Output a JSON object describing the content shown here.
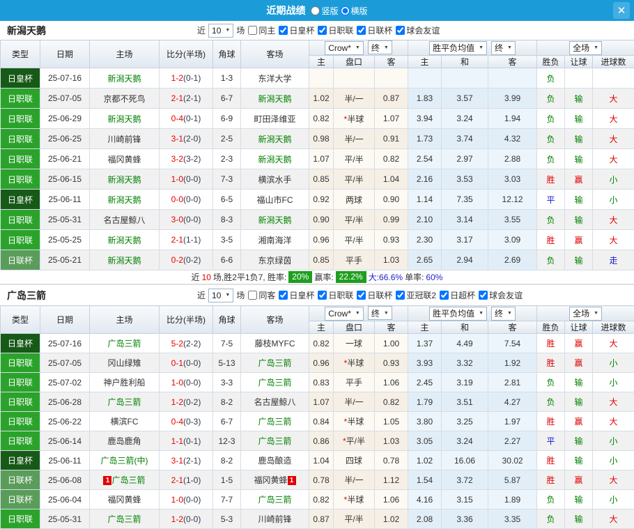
{
  "titlebar": {
    "title": "近期战绩",
    "mode_vertical": "竖版",
    "mode_horizontal": "横版",
    "mode_selected": "横版",
    "close_icon": "✕"
  },
  "colors": {
    "type": {
      "日皇杯": "#175917",
      "日职联": "#2ba32b",
      "日联杯": "#5a9c5a"
    },
    "outcome": {
      "胜": "#e10000",
      "平": "#1414d2",
      "负": "#008000",
      "赢": "#e10000",
      "输": "#008000",
      "走": "#1414d2",
      "大": "#e10000",
      "小": "#008000"
    },
    "focus_team": "#008000",
    "score": "#e60000",
    "badge": "#1f9e1f",
    "titlebar": "#1b9cd8"
  },
  "table_header": {
    "type": "类型",
    "date": "日期",
    "home": "主场",
    "score": "比分(半场)",
    "corner": "角球",
    "away": "客场",
    "crow_dd": "Crow*",
    "final_dd": "终",
    "mean_dd": "胜平负均值",
    "full_dd": "全场",
    "sub": [
      "主",
      "盘口",
      "客",
      "主",
      "和",
      "客",
      "胜负",
      "让球",
      "进球数"
    ]
  },
  "sections": [
    {
      "team": "新潟天鹅",
      "filter": {
        "near": "近",
        "count": "10",
        "games": "场",
        "same": "同主",
        "same_checked": false,
        "leagues": [
          "日皇杯",
          "日职联",
          "日联杯",
          "球会友谊"
        ]
      },
      "rows": [
        {
          "type": "日皇杯",
          "date": "25-07-16",
          "home": "新潟天鹅",
          "home_focus": true,
          "home_card": "",
          "score": "1-2",
          "half": "(0-1)",
          "corner": "1-3",
          "away": "东洋大学",
          "away_focus": false,
          "away_card": "",
          "odds": [
            "",
            "",
            ""
          ],
          "mean": [
            "",
            "",
            ""
          ],
          "results": [
            "负",
            "",
            ""
          ]
        },
        {
          "type": "日职联",
          "date": "25-07-05",
          "home": "京都不死鸟",
          "home_focus": false,
          "home_card": "",
          "score": "2-1",
          "half": "(2-1)",
          "corner": "6-7",
          "away": "新潟天鹅",
          "away_focus": true,
          "away_card": "",
          "odds": [
            "1.02",
            "半/一",
            "0.87"
          ],
          "mean": [
            "1.83",
            "3.57",
            "3.99"
          ],
          "results": [
            "负",
            "输",
            "大"
          ]
        },
        {
          "type": "日职联",
          "date": "25-06-29",
          "home": "新潟天鹅",
          "home_focus": true,
          "home_card": "",
          "score": "0-4",
          "half": "(0-1)",
          "corner": "6-9",
          "away": "町田泽维亚",
          "away_focus": false,
          "away_card": "",
          "odds": [
            "0.82",
            "*半球",
            "1.07"
          ],
          "mean": [
            "3.94",
            "3.24",
            "1.94"
          ],
          "results": [
            "负",
            "输",
            "大"
          ]
        },
        {
          "type": "日职联",
          "date": "25-06-25",
          "home": "川崎前锋",
          "home_focus": false,
          "home_card": "",
          "score": "3-1",
          "half": "(2-0)",
          "corner": "2-5",
          "away": "新潟天鹅",
          "away_focus": true,
          "away_card": "",
          "odds": [
            "0.98",
            "半/一",
            "0.91"
          ],
          "mean": [
            "1.73",
            "3.74",
            "4.32"
          ],
          "results": [
            "负",
            "输",
            "大"
          ]
        },
        {
          "type": "日职联",
          "date": "25-06-21",
          "home": "福冈黄蜂",
          "home_focus": false,
          "home_card": "",
          "score": "3-2",
          "half": "(3-2)",
          "corner": "2-3",
          "away": "新潟天鹅",
          "away_focus": true,
          "away_card": "",
          "odds": [
            "1.07",
            "平/半",
            "0.82"
          ],
          "mean": [
            "2.54",
            "2.97",
            "2.88"
          ],
          "results": [
            "负",
            "输",
            "大"
          ]
        },
        {
          "type": "日职联",
          "date": "25-06-15",
          "home": "新潟天鹅",
          "home_focus": true,
          "home_card": "",
          "score": "1-0",
          "half": "(0-0)",
          "corner": "7-3",
          "away": "横滨水手",
          "away_focus": false,
          "away_card": "",
          "odds": [
            "0.85",
            "平/半",
            "1.04"
          ],
          "mean": [
            "2.16",
            "3.53",
            "3.03"
          ],
          "results": [
            "胜",
            "赢",
            "小"
          ]
        },
        {
          "type": "日皇杯",
          "date": "25-06-11",
          "home": "新潟天鹅",
          "home_focus": true,
          "home_card": "",
          "score": "0-0",
          "half": "(0-0)",
          "corner": "6-5",
          "away": "福山市FC",
          "away_focus": false,
          "away_card": "",
          "odds": [
            "0.92",
            "两球",
            "0.90"
          ],
          "mean": [
            "1.14",
            "7.35",
            "12.12"
          ],
          "results": [
            "平",
            "输",
            "小"
          ]
        },
        {
          "type": "日职联",
          "date": "25-05-31",
          "home": "名古屋鲸八",
          "home_focus": false,
          "home_card": "",
          "score": "3-0",
          "half": "(0-0)",
          "corner": "8-3",
          "away": "新潟天鹅",
          "away_focus": true,
          "away_card": "",
          "odds": [
            "0.90",
            "平/半",
            "0.99"
          ],
          "mean": [
            "2.10",
            "3.14",
            "3.55"
          ],
          "results": [
            "负",
            "输",
            "大"
          ]
        },
        {
          "type": "日职联",
          "date": "25-05-25",
          "home": "新潟天鹅",
          "home_focus": true,
          "home_card": "",
          "score": "2-1",
          "half": "(1-1)",
          "corner": "3-5",
          "away": "湘南海洋",
          "away_focus": false,
          "away_card": "",
          "odds": [
            "0.96",
            "平/半",
            "0.93"
          ],
          "mean": [
            "2.30",
            "3.17",
            "3.09"
          ],
          "results": [
            "胜",
            "赢",
            "大"
          ]
        },
        {
          "type": "日联杯",
          "date": "25-05-21",
          "home": "新潟天鹅",
          "home_focus": true,
          "home_card": "",
          "score": "0-2",
          "half": "(0-2)",
          "corner": "6-6",
          "away": "东京绿茵",
          "away_focus": false,
          "away_card": "",
          "odds": [
            "0.85",
            "平手",
            "1.03"
          ],
          "mean": [
            "2.65",
            "2.94",
            "2.69"
          ],
          "results": [
            "负",
            "输",
            "走"
          ]
        }
      ],
      "summary": {
        "near": "近",
        "count": "10",
        "record": "场,胜2平1负7, 胜率:",
        "win_rate": "20%",
        "profit_label": "赢率:",
        "profit_rate": "22.2%",
        "big": "大:66.6%",
        "single_label": "单率:",
        "single_value": "60%"
      }
    },
    {
      "team": "广岛三箭",
      "filter": {
        "near": "近",
        "count": "10",
        "games": "场",
        "same": "同客",
        "same_checked": false,
        "leagues": [
          "日皇杯",
          "日职联",
          "日联杯",
          "亚冠联2",
          "日超杯",
          "球会友谊"
        ]
      },
      "rows": [
        {
          "type": "日皇杯",
          "date": "25-07-16",
          "home": "广岛三箭",
          "home_focus": true,
          "home_card": "",
          "score": "5-2",
          "half": "(2-2)",
          "corner": "7-5",
          "away": "藤枝MYFC",
          "away_focus": false,
          "away_card": "",
          "odds": [
            "0.82",
            "一球",
            "1.00"
          ],
          "mean": [
            "1.37",
            "4.49",
            "7.54"
          ],
          "results": [
            "胜",
            "赢",
            "大"
          ]
        },
        {
          "type": "日职联",
          "date": "25-07-05",
          "home": "冈山绿雉",
          "home_focus": false,
          "home_card": "",
          "score": "0-1",
          "half": "(0-0)",
          "corner": "5-13",
          "away": "广岛三箭",
          "away_focus": true,
          "away_card": "",
          "odds": [
            "0.96",
            "*半球",
            "0.93"
          ],
          "mean": [
            "3.93",
            "3.32",
            "1.92"
          ],
          "results": [
            "胜",
            "赢",
            "小"
          ]
        },
        {
          "type": "日职联",
          "date": "25-07-02",
          "home": "神户胜利船",
          "home_focus": false,
          "home_card": "",
          "score": "1-0",
          "half": "(0-0)",
          "corner": "3-3",
          "away": "广岛三箭",
          "away_focus": true,
          "away_card": "",
          "odds": [
            "0.83",
            "平手",
            "1.06"
          ],
          "mean": [
            "2.45",
            "3.19",
            "2.81"
          ],
          "results": [
            "负",
            "输",
            "小"
          ]
        },
        {
          "type": "日职联",
          "date": "25-06-28",
          "home": "广岛三箭",
          "home_focus": true,
          "home_card": "",
          "score": "1-2",
          "half": "(0-2)",
          "corner": "8-2",
          "away": "名古屋鲸八",
          "away_focus": false,
          "away_card": "",
          "odds": [
            "1.07",
            "半/一",
            "0.82"
          ],
          "mean": [
            "1.79",
            "3.51",
            "4.27"
          ],
          "results": [
            "负",
            "输",
            "大"
          ]
        },
        {
          "type": "日职联",
          "date": "25-06-22",
          "home": "横滨FC",
          "home_focus": false,
          "home_card": "",
          "score": "0-4",
          "half": "(0-3)",
          "corner": "6-7",
          "away": "广岛三箭",
          "away_focus": true,
          "away_card": "",
          "odds": [
            "0.84",
            "*半球",
            "1.05"
          ],
          "mean": [
            "3.80",
            "3.25",
            "1.97"
          ],
          "results": [
            "胜",
            "赢",
            "大"
          ]
        },
        {
          "type": "日职联",
          "date": "25-06-14",
          "home": "鹿岛鹿角",
          "home_focus": false,
          "home_card": "",
          "score": "1-1",
          "half": "(0-1)",
          "corner": "12-3",
          "away": "广岛三箭",
          "away_focus": true,
          "away_card": "",
          "odds": [
            "0.86",
            "*平/半",
            "1.03"
          ],
          "mean": [
            "3.05",
            "3.24",
            "2.27"
          ],
          "results": [
            "平",
            "输",
            "小"
          ]
        },
        {
          "type": "日皇杯",
          "date": "25-06-11",
          "home": "广岛三箭(中)",
          "home_focus": true,
          "home_card": "",
          "score": "3-1",
          "half": "(2-1)",
          "corner": "8-2",
          "away": "鹿岛酿造",
          "away_focus": false,
          "away_card": "",
          "odds": [
            "1.04",
            "四球",
            "0.78"
          ],
          "mean": [
            "1.02",
            "16.06",
            "30.02"
          ],
          "results": [
            "胜",
            "输",
            "小"
          ]
        },
        {
          "type": "日联杯",
          "date": "25-06-08",
          "home": "广岛三箭",
          "home_focus": true,
          "home_card": "1",
          "score": "2-1",
          "half": "(1-0)",
          "corner": "1-5",
          "away": "福冈黄蜂",
          "away_focus": false,
          "away_card": "1",
          "odds": [
            "0.78",
            "半/一",
            "1.12"
          ],
          "mean": [
            "1.54",
            "3.72",
            "5.87"
          ],
          "results": [
            "胜",
            "赢",
            "大"
          ]
        },
        {
          "type": "日联杯",
          "date": "25-06-04",
          "home": "福冈黄蜂",
          "home_focus": false,
          "home_card": "",
          "score": "1-0",
          "half": "(0-0)",
          "corner": "7-7",
          "away": "广岛三箭",
          "away_focus": true,
          "away_card": "",
          "odds": [
            "0.82",
            "*半球",
            "1.06"
          ],
          "mean": [
            "4.16",
            "3.15",
            "1.89"
          ],
          "results": [
            "负",
            "输",
            "小"
          ]
        },
        {
          "type": "日职联",
          "date": "25-05-31",
          "home": "广岛三箭",
          "home_focus": true,
          "home_card": "",
          "score": "1-2",
          "half": "(0-0)",
          "corner": "5-3",
          "away": "川崎前锋",
          "away_focus": false,
          "away_card": "",
          "odds": [
            "0.87",
            "平/半",
            "1.02"
          ],
          "mean": [
            "2.08",
            "3.36",
            "3.35"
          ],
          "results": [
            "负",
            "输",
            "大"
          ]
        }
      ]
    }
  ]
}
